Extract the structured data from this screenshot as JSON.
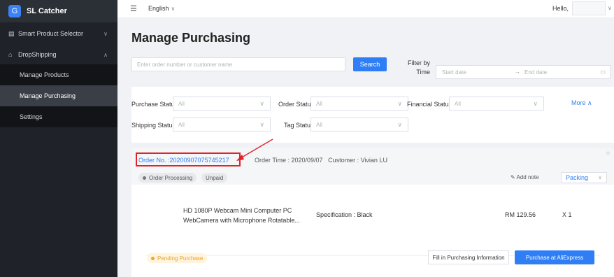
{
  "app": {
    "name": "SL Catcher"
  },
  "sidebar": {
    "items": [
      {
        "label": "Smart Product Selector",
        "icon": "grid-icon",
        "chevron": "∨"
      },
      {
        "label": "DropShipping",
        "icon": "bag-icon",
        "chevron": "∧"
      }
    ],
    "sub_items": [
      {
        "label": "Manage Products"
      },
      {
        "label": "Manage Purchasing"
      },
      {
        "label": "Settings"
      }
    ]
  },
  "topbar": {
    "language": "English",
    "greeting": "Hello,"
  },
  "page": {
    "title": "Manage Purchasing"
  },
  "search": {
    "placeholder": "Enter order number or customer name",
    "button": "Search",
    "filter_by_line1": "Filter by",
    "filter_by_line2": "Time",
    "start_date": "Start date",
    "end_date": "End date"
  },
  "filters": {
    "purchase_status": {
      "label": "Purchase Status",
      "value": "All"
    },
    "order_status": {
      "label": "Order Status",
      "value": "All"
    },
    "financial_status": {
      "label": "Financial Status",
      "value": "All"
    },
    "shipping_status": {
      "label": "Shipping Status",
      "value": "All"
    },
    "tag_status": {
      "label": "Tag Status",
      "value": "All"
    },
    "more": "More ∧"
  },
  "order": {
    "number": "Order No. :20200907075745217",
    "time": "Order Time : 2020/09/07",
    "customer": "Customer : Vivian LU",
    "badges": [
      "Order Processing",
      "Unpaid"
    ],
    "add_note": "Add note",
    "packing": "Packing",
    "product": {
      "name": "HD 1080P Webcam Mini Computer PC WebCamera with Microphone Rotatable...",
      "spec": "Specification : Black",
      "price": "RM 129.56",
      "qty": "X 1"
    },
    "purchase_status": "Pending Purchase",
    "fill_button": "Fill in Purchasing Information",
    "buy_button": "Purchase at AliExpress"
  },
  "colors": {
    "accent": "#2f7ef5",
    "annotation": "#e0242b",
    "sidebar": "#1f2329"
  }
}
